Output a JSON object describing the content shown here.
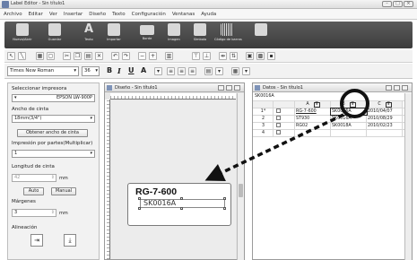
{
  "window": {
    "title": "Label Editor - Sin título1"
  },
  "menu": [
    "Archivo",
    "Editar",
    "Ver",
    "Insertar",
    "Diseño",
    "Texto",
    "Configuración",
    "Ventanas",
    "Ayuda"
  ],
  "ribbon": [
    {
      "label": "Nuevo/Abrir",
      "icon": "document-icon"
    },
    {
      "label": "Guardar",
      "icon": "save-icon"
    },
    {
      "label": "Texto",
      "icon": "text-icon"
    },
    {
      "label": "Importar",
      "icon": "import-icon"
    },
    {
      "label": "Borde",
      "icon": "frame-icon"
    },
    {
      "label": "Imagen",
      "icon": "image-icon"
    },
    {
      "label": "Símbolo",
      "icon": "symbol-icon"
    },
    {
      "label": "Código de barras",
      "icon": "barcode-icon"
    },
    {
      "label": "",
      "icon": "print-icon"
    }
  ],
  "format": {
    "font": "Times New Roman",
    "size": "36"
  },
  "left_panel": {
    "printer_label": "Seleccionar impresora",
    "printer_value": "EPSON LW-900P",
    "tape_label": "Ancho de cinta",
    "tape_value": "18mm(3/4\")",
    "get_tape_button": "Obtener ancho de cinta",
    "print_parts_label": "Impresión por partes(Multiplicar)",
    "print_parts_value": "1",
    "tape_length_label": "Longitud de cinta",
    "tape_length_value": "42",
    "unit_mm": "mm",
    "auto_button": "Auto",
    "manual_button": "Manual",
    "margins_label": "Márgenes",
    "margins_value": "3",
    "align_label": "Alineación"
  },
  "editor": {
    "title": "Diseño - Sin título1",
    "text1": "RG-7-600",
    "text2": "SK0016A"
  },
  "data_window": {
    "title": "Datos - Sin título1",
    "name_box": "SK0016A",
    "columns": [
      "A",
      "B",
      "C"
    ],
    "rows": [
      {
        "num": "1*",
        "a": "RG-7-600",
        "b": "SK0016A",
        "c": "2010/04/07"
      },
      {
        "num": "2",
        "a": "ST930",
        "b": "SK0016A",
        "c": "2010/08/29"
      },
      {
        "num": "3",
        "a": "RG02",
        "b": "SK0018A",
        "c": "2010/02/23"
      },
      {
        "num": "4",
        "a": "",
        "b": "",
        "c": ""
      }
    ]
  },
  "colors": {
    "ribbon": "#454545",
    "panel": "#f2f2f2",
    "accent": "#111111"
  }
}
